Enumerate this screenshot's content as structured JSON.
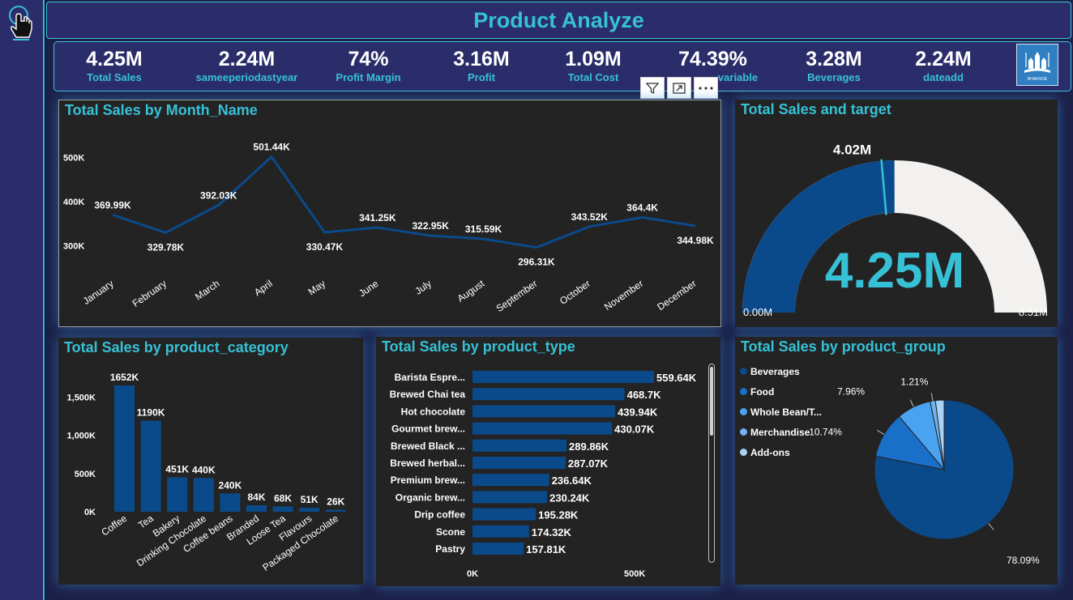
{
  "header": {
    "title": "Product Analyze"
  },
  "kpis": [
    {
      "value": "4.25M",
      "label": "Total Sales"
    },
    {
      "value": "2.24M",
      "label": "sameeperiodastyear"
    },
    {
      "value": "74%",
      "label": "Profit Margin"
    },
    {
      "value": "3.16M",
      "label": "Profit"
    },
    {
      "value": "1.09M",
      "label": "Total Cost"
    },
    {
      "value": "74.39%",
      "label": "variable"
    },
    {
      "value": "3.28M",
      "label": "Beverages"
    },
    {
      "value": "2.24M",
      "label": "dateadd"
    }
  ],
  "logo": {
    "text": "BHARSOE"
  },
  "colors": {
    "accent": "#36c1d6",
    "bar": "#0b4a8a",
    "panel": "#232323"
  },
  "icons": {
    "sidebar": "hand-pointer-icon",
    "toolbar": [
      "filter-icon",
      "focus-mode-icon",
      "more-options-icon"
    ]
  },
  "chart_data": [
    {
      "type": "line",
      "title": "Total Sales by Month_Name",
      "categories": [
        "January",
        "February",
        "March",
        "April",
        "May",
        "June",
        "July",
        "August",
        "September",
        "October",
        "November",
        "December"
      ],
      "values": [
        369990,
        329780,
        392030,
        501440,
        330470,
        341250,
        322950,
        315590,
        296310,
        343520,
        364400,
        344980
      ],
      "data_labels": [
        "369.99K",
        "329.78K",
        "392.03K",
        "501.44K",
        "330.47K",
        "341.25K",
        "322.95K",
        "315.59K",
        "296.31K",
        "343.52K",
        "364.4K",
        "344.98K"
      ],
      "yticks": [
        300000,
        400000,
        500000
      ],
      "ytick_labels": [
        "300K",
        "400K",
        "500K"
      ],
      "ylim": [
        290000,
        510000
      ],
      "grid": false
    },
    {
      "type": "gauge",
      "title": "Total Sales and target",
      "value": 4.25,
      "value_label": "4.25M",
      "target": 4.02,
      "target_label": "4.02M",
      "min": 0,
      "max": 8.51,
      "min_label": "0.00M",
      "max_label": "8.51M"
    },
    {
      "type": "bar",
      "title": "Total Sales by product_category",
      "categories": [
        "Coffee",
        "Tea",
        "Bakery",
        "Drinking Chocolate",
        "Coffee beans",
        "Branded",
        "Loose Tea",
        "Flavours",
        "Packaged Chocolate"
      ],
      "values": [
        1652,
        1190,
        451,
        440,
        240,
        84,
        68,
        51,
        26
      ],
      "data_labels": [
        "1652K",
        "1190K",
        "451K",
        "440K",
        "240K",
        "84K",
        "68K",
        "51K",
        "26K"
      ],
      "yticks": [
        0,
        500,
        1000,
        1500
      ],
      "ytick_labels": [
        "0K",
        "500K",
        "1,000K",
        "1,500K"
      ],
      "ylim": [
        0,
        1652
      ]
    },
    {
      "type": "bar",
      "orientation": "horizontal",
      "title": "Total Sales by product_type",
      "categories": [
        "Barista Espre...",
        "Brewed Chai tea",
        "Hot chocolate",
        "Gourmet brew...",
        "Brewed Black ...",
        "Brewed herbal...",
        "Premium brew...",
        "Organic brew...",
        "Drip coffee",
        "Scone",
        "Pastry"
      ],
      "values": [
        559.64,
        468.7,
        439.94,
        430.07,
        289.86,
        287.07,
        236.64,
        230.24,
        195.28,
        174.32,
        157.81
      ],
      "data_labels": [
        "559.64K",
        "468.7K",
        "439.94K",
        "430.07K",
        "289.86K",
        "287.07K",
        "236.64K",
        "230.24K",
        "195.28K",
        "174.32K",
        "157.81K"
      ],
      "xticks": [
        0,
        500
      ],
      "xtick_labels": [
        "0K",
        "500K"
      ],
      "xlim": [
        0,
        559.64
      ]
    },
    {
      "type": "pie",
      "title": "Total Sales by product_group",
      "series": [
        {
          "name": "Beverages",
          "value": 78.09,
          "label": "78.09%",
          "color": "#0b4a8a"
        },
        {
          "name": "Food",
          "value": 10.74,
          "label": "10.74%",
          "color": "#1a6fc9"
        },
        {
          "name": "Whole Bean/T...",
          "value": 7.96,
          "label": "7.96%",
          "color": "#4aa3f0"
        },
        {
          "name": "Merchandise",
          "value": 1.21,
          "label": "1.21%",
          "color": "#6fb4ee"
        },
        {
          "name": "Add-ons",
          "value": 2.0,
          "label": "",
          "color": "#a9d3f6"
        }
      ],
      "legend_position": "left"
    }
  ]
}
